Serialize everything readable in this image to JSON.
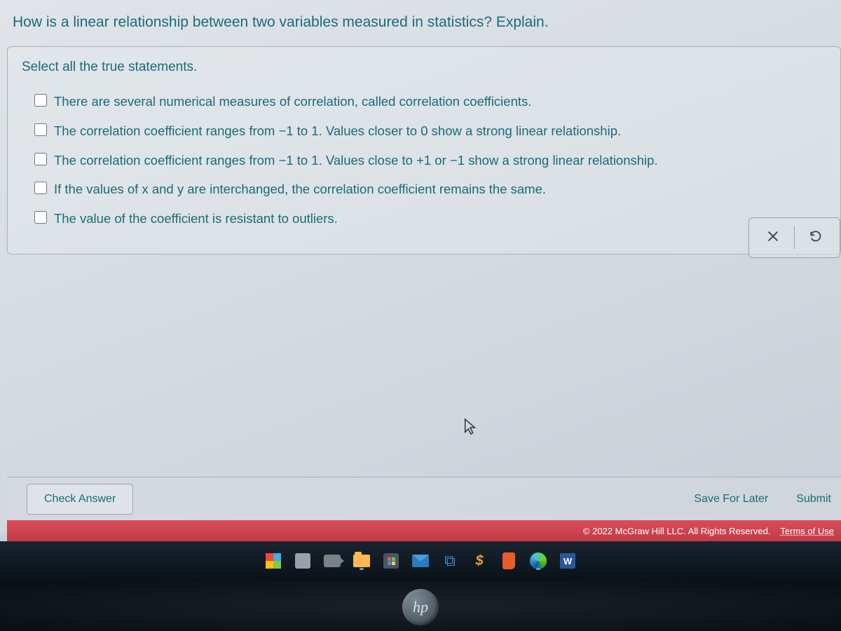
{
  "question": "How is a linear relationship between two variables measured in statistics? Explain.",
  "instruction": "Select all the true statements.",
  "options": [
    "There are several numerical measures of correlation, called correlation coefficients.",
    "The correlation coefficient ranges from −1 to 1. Values closer to 0 show a strong linear relationship.",
    "The correlation coefficient ranges from −1 to 1. Values close to +1 or −1 show a strong linear relationship.",
    "If the values of x and y are interchanged, the correlation coefficient remains the same.",
    "The value of the coefficient is resistant to outliers."
  ],
  "buttons": {
    "check": "Check Answer",
    "save": "Save For Later",
    "submit": "Submit"
  },
  "footer": {
    "copyright": "© 2022 McGraw Hill LLC. All Rights Reserved.",
    "terms": "Terms of Use"
  },
  "hp_logo": "hp",
  "word_icon_letter": "W",
  "dollar_sign": "$",
  "dropbox_glyph": "⧉"
}
